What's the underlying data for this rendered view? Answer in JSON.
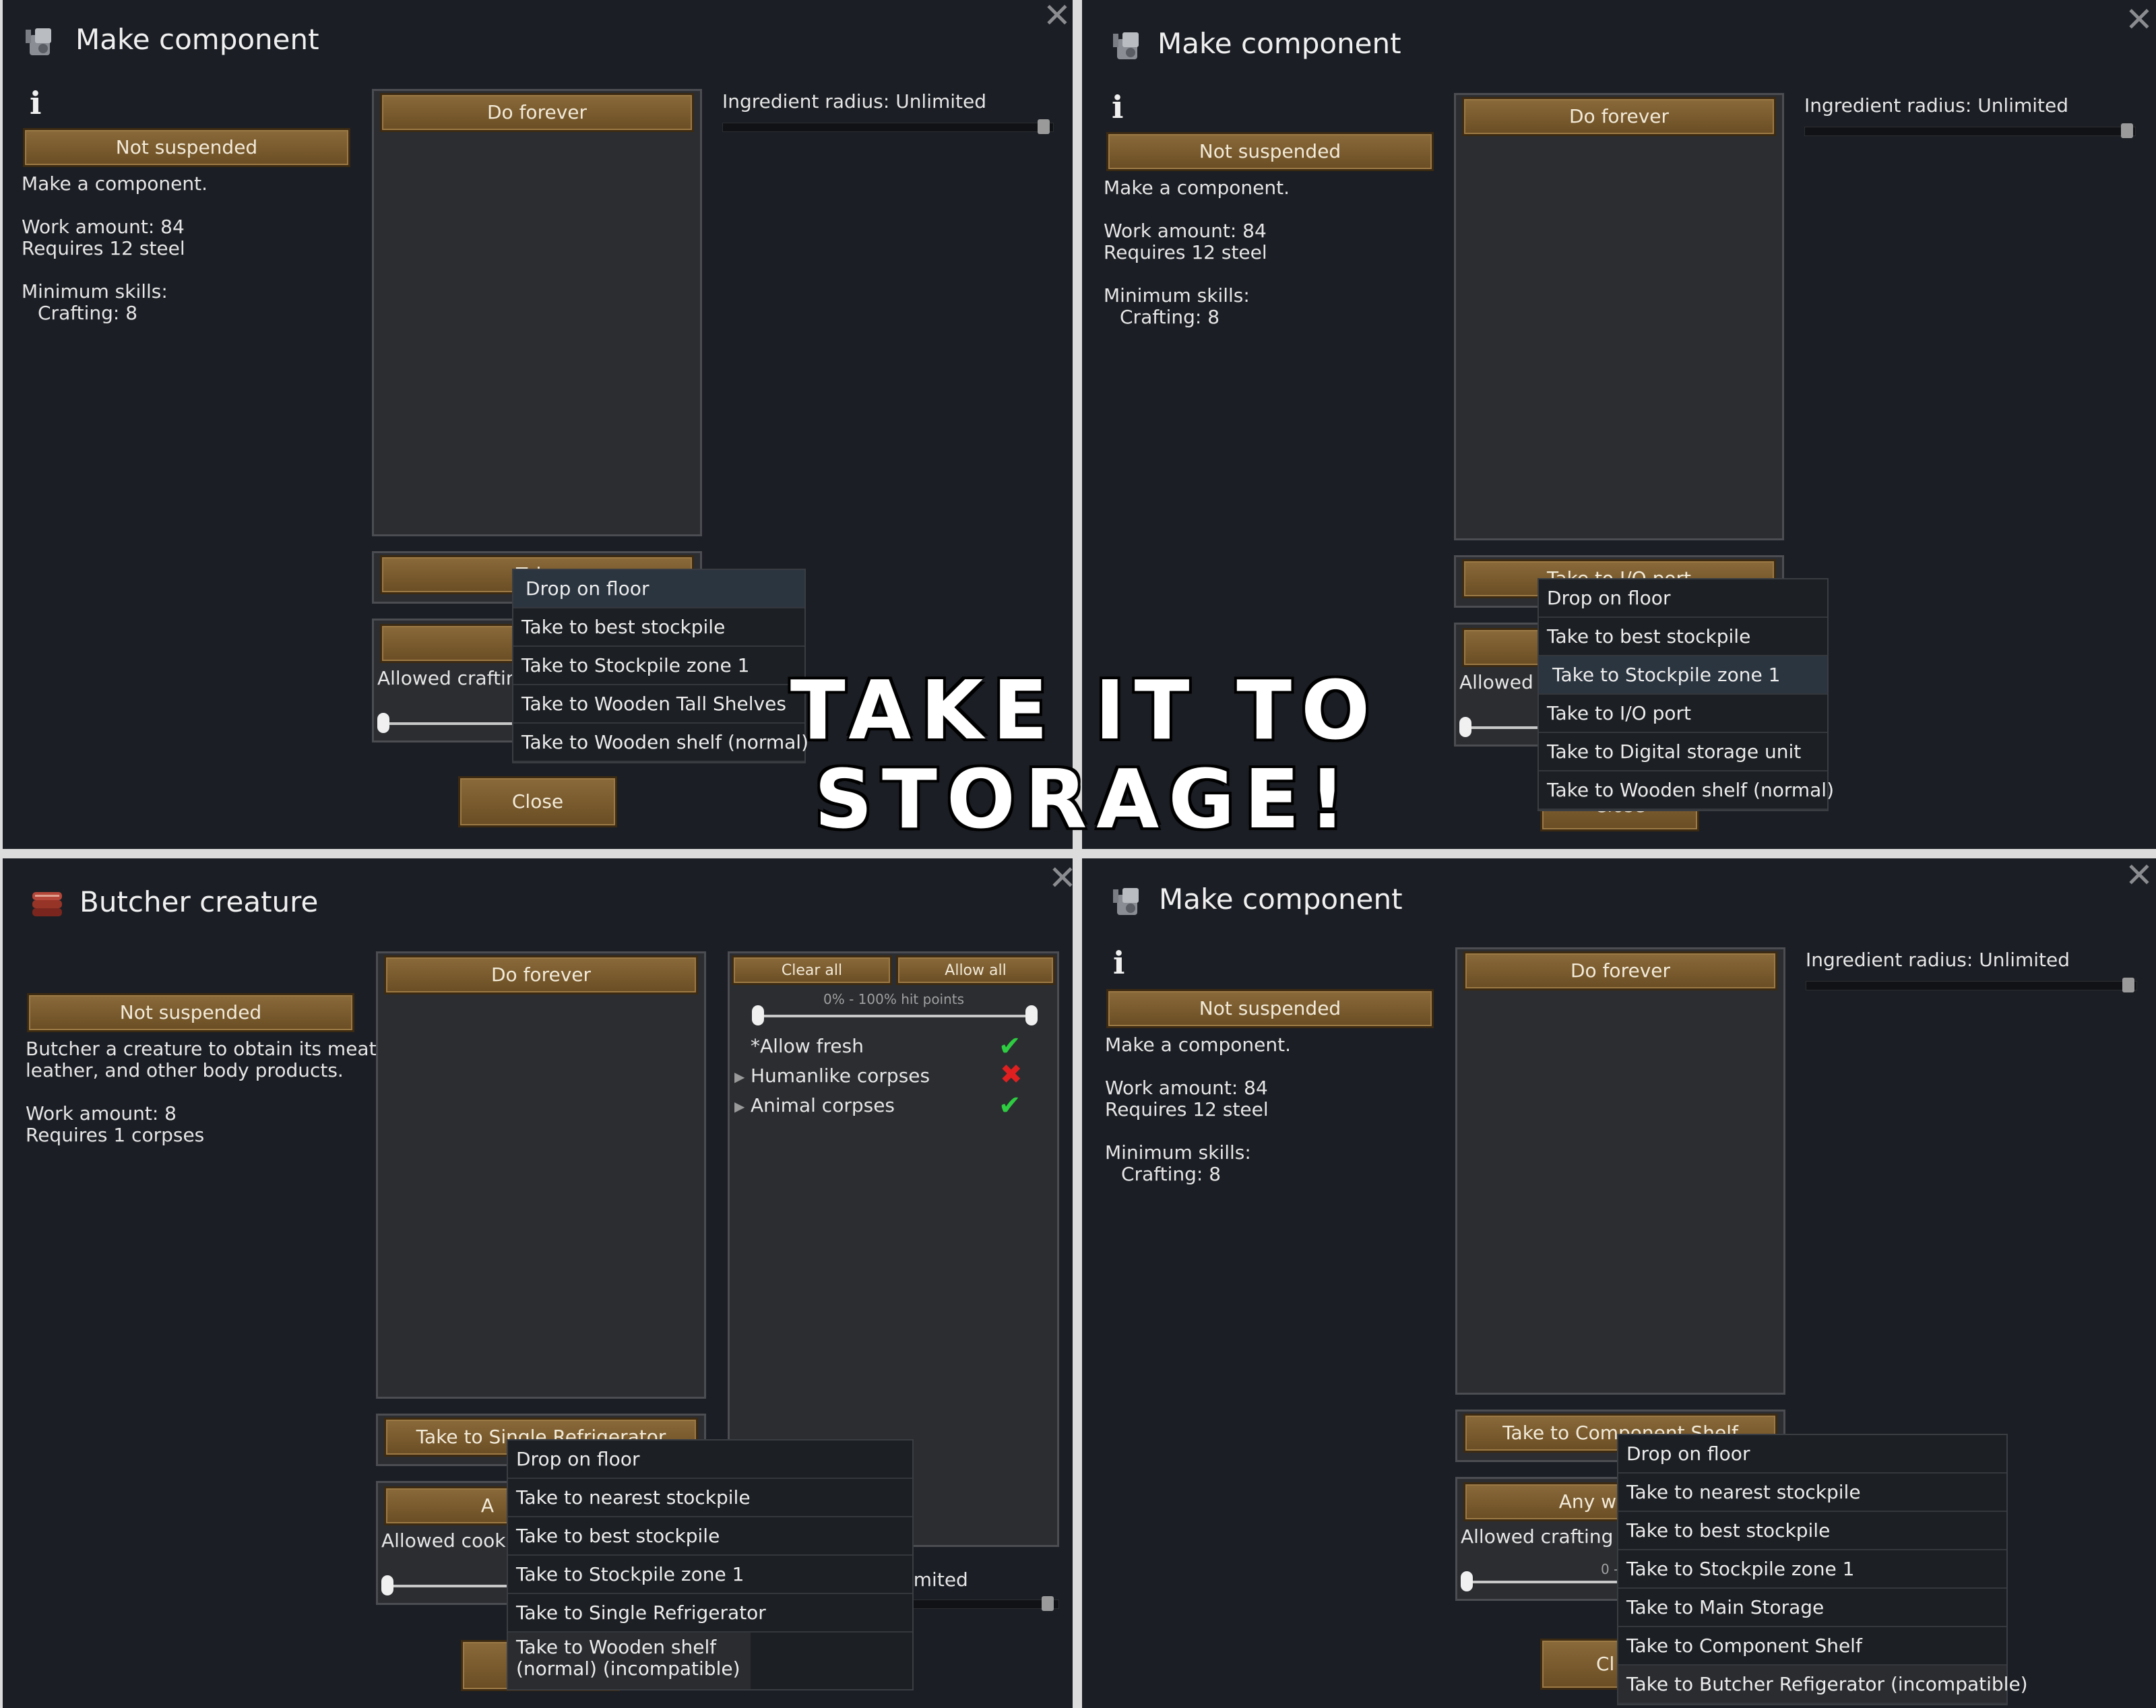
{
  "panel1": {
    "title": "Make component",
    "not_suspended": "Not suspended",
    "description": "Make a component.",
    "work_amount": "Work amount: 84",
    "requires": "Requires 12 steel",
    "min_skills": "Minimum skills:",
    "skill": "Crafting: 8",
    "repeat_button": "Do forever",
    "ingredient_radius": "Ingredient radius: Unlimited",
    "store_button": "Take",
    "worker_button": "An",
    "allowed_skill": "Allowed crafting",
    "close": "Close",
    "menu": [
      "Drop on floor",
      "Take to best stockpile",
      "Take to Stockpile zone 1",
      "Take to Wooden Tall Shelves",
      "Take to Wooden shelf (normal)"
    ]
  },
  "panel2": {
    "title": "Make component",
    "not_suspended": "Not suspended",
    "description": "Make a component.",
    "work_amount": "Work amount: 84",
    "requires": "Requires 12 steel",
    "min_skills": "Minimum skills:",
    "skill": "Crafting: 8",
    "repeat_button": "Do forever",
    "ingredient_radius": "Ingredient radius: Unlimited",
    "store_button": "Take to I/O port",
    "allowed_skill": "Allowed c",
    "close": "Close",
    "menu": [
      "Drop on floor",
      "Take to best stockpile",
      "Take to Stockpile zone 1",
      "Take to I/O port",
      "Take to Digital storage unit",
      "Take to Wooden shelf (normal)"
    ]
  },
  "panel3": {
    "title": "Butcher creature",
    "not_suspended": "Not suspended",
    "description_1": "Butcher a creature to obtain its meat,",
    "description_2": "leather, and other body products.",
    "work_amount": "Work amount: 8",
    "requires": "Requires 1 corpses",
    "repeat_button": "Do forever",
    "clear_all": "Clear all",
    "allow_all": "Allow all",
    "hit_points": "0% - 100% hit points",
    "filters": [
      {
        "label": "*Allow fresh",
        "state": "allowed"
      },
      {
        "label": "Humanlike corpses",
        "state": "disallowed"
      },
      {
        "label": "Animal corpses",
        "state": "allowed"
      }
    ],
    "store_button": "Take to Single Refrigerator",
    "worker_button": "A",
    "allowed_skill": "Allowed cookin",
    "radius_partial": "imited",
    "menu": [
      "Drop on floor",
      "Take to nearest stockpile",
      "Take to best stockpile",
      "Take to Stockpile zone 1",
      "Take to Single Refrigerator",
      "Take to Wooden shelf (normal) (incompatible)"
    ]
  },
  "panel4": {
    "title": "Make component",
    "not_suspended": "Not suspended",
    "description": "Make a component.",
    "work_amount": "Work amount: 84",
    "requires": "Requires 12 steel",
    "min_skills": "Minimum skills:",
    "skill": "Crafting: 8",
    "repeat_button": "Do forever",
    "ingredient_radius": "Ingredient radius: Unlimited",
    "store_button": "Take to Component Shelf",
    "worker_button": "Any w",
    "allowed_skill": "Allowed crafting sk",
    "range_partial": "0 -",
    "close": "Cl",
    "menu": [
      "Drop on floor",
      "Take to nearest stockpile",
      "Take to best stockpile",
      "Take to Stockpile zone 1",
      "Take to Main Storage",
      "Take to Component Shelf",
      "Take to Butcher Refigerator (incompatible)"
    ]
  },
  "caption": "TAKE IT TO STORAGE!",
  "colors": {
    "window_bg": "#1b1e24",
    "button_brown": "#7a5a2e",
    "check_green": "#2ecc40",
    "cross_red": "#e02020"
  },
  "icons": {
    "component": "component-icon",
    "meat": "meat-icon",
    "info": "info-icon",
    "close": "close-icon"
  }
}
